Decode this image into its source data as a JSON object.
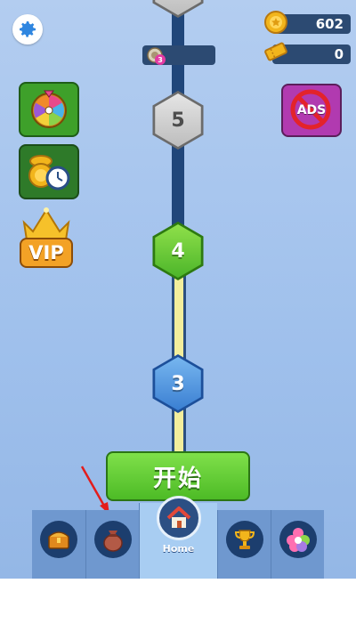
{
  "currency": {
    "coins": "602",
    "tickets": "0"
  },
  "level_progress": {
    "badge": "3"
  },
  "path": {
    "levels": [
      "5",
      "4",
      "3"
    ]
  },
  "side_buttons": {
    "vip_label": "VIP",
    "no_ads_label": "ADS"
  },
  "start_button": {
    "label": "开始"
  },
  "nav": {
    "tabs": [
      {
        "label": "",
        "icon": "treasure-chest-icon"
      },
      {
        "label": "",
        "icon": "money-bag-icon"
      },
      {
        "label": "Home",
        "icon": "house-icon",
        "active": true
      },
      {
        "label": "",
        "icon": "trophy-icon"
      },
      {
        "label": "",
        "icon": "flower-star-icon"
      }
    ]
  },
  "colors": {
    "track_dark": "#20467a",
    "track_path": "#f3ee9c",
    "start_green": "#4dbb26",
    "arrow": "#e31c1c"
  }
}
